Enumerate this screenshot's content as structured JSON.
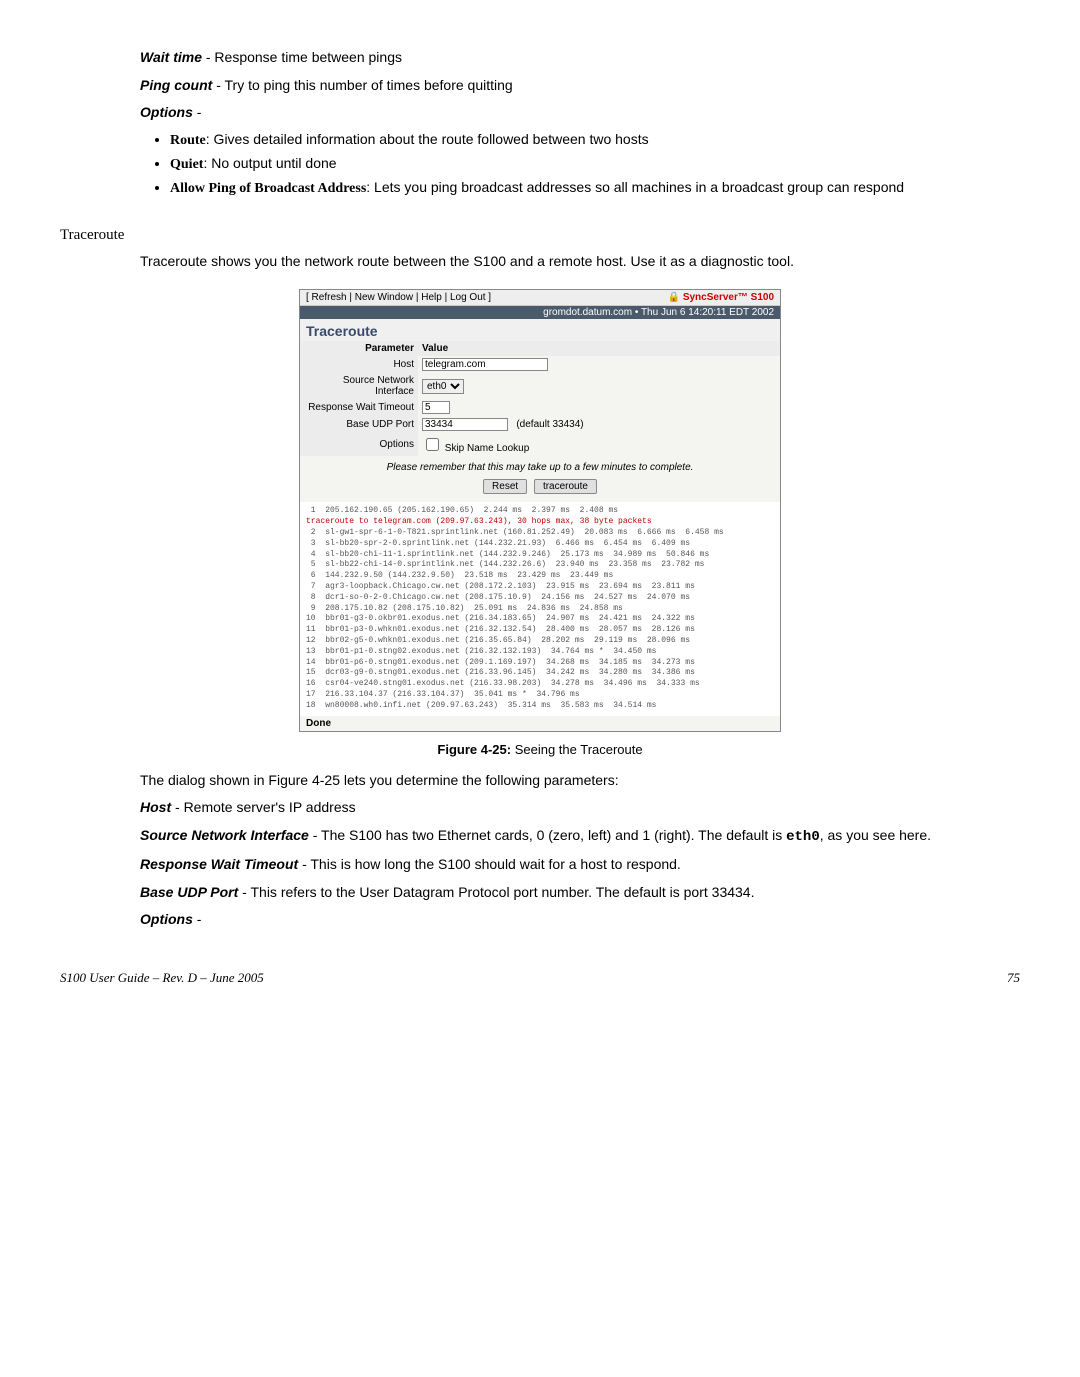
{
  "p1_label": "Wait time",
  "p1_text": " - Response time between pings",
  "p2_label": "Ping count",
  "p2_text": " - Try to ping this number of times before quitting",
  "p3_label": "Options",
  "p3_text": " -",
  "bullets": {
    "b1_label": "Route",
    "b1_text": ": Gives detailed information about the route followed between two hosts",
    "b2_label": "Quiet",
    "b2_text": ": No output until done",
    "b3_label": "Allow Ping of Broadcast Address",
    "b3_text": ": Lets you ping broadcast addresses so all machines in a broadcast group can respond"
  },
  "section_head": "Traceroute",
  "section_body": "Traceroute shows you the network route between the S100 and a remote host. Use it as a diagnostic tool.",
  "figure": {
    "links": "[ Refresh | New Window | Help | Log Out ]",
    "brand": "SyncServer™ S100",
    "banner": "gromdot.datum.com • Thu Jun 6 14:20:11 EDT 2002",
    "title": "Traceroute",
    "row_param": "Parameter",
    "row_val": "Value",
    "host_label": "Host",
    "host_value": "telegram.com",
    "sni_label": "Source Network Interface",
    "sni_value": "eth0",
    "rwt_label": "Response Wait Timeout",
    "rwt_value": "5",
    "bup_label": "Base UDP Port",
    "bup_value": "33434",
    "bup_note": "(default 33434)",
    "opt_label": "Options",
    "opt_check": "Skip Name Lookup",
    "note": "Please remember that this may take up to a few minutes to complete.",
    "btn_reset": "Reset",
    "btn_trace": "traceroute",
    "trace_lines": [
      " 1  205.162.190.65 (205.162.190.65)  2.244 ms  2.397 ms  2.408 ms",
      "traceroute to telegram.com (209.97.63.243), 30 hops max, 38 byte packets",
      " 2  sl-gw1-spr-6-1-0-T821.sprintlink.net (160.81.252.49)  20.083 ms  6.666 ms  6.458 ms",
      " 3  sl-bb20-spr-2-0.sprintlink.net (144.232.21.93)  6.466 ms  6.454 ms  6.409 ms",
      " 4  sl-bb20-chi-11-1.sprintlink.net (144.232.9.246)  25.173 ms  34.989 ms  50.846 ms",
      " 5  sl-bb22-chi-14-0.sprintlink.net (144.232.26.6)  23.940 ms  23.358 ms  23.782 ms",
      " 6  144.232.9.50 (144.232.9.50)  23.518 ms  23.429 ms  23.449 ms",
      " 7  agr3-loopback.Chicago.cw.net (208.172.2.103)  23.915 ms  23.694 ms  23.811 ms",
      " 8  dcr1-so-0-2-0.Chicago.cw.net (208.175.10.9)  24.156 ms  24.527 ms  24.070 ms",
      " 9  208.175.10.82 (208.175.10.82)  25.091 ms  24.836 ms  24.858 ms",
      "10  bbr01-g3-0.okbr01.exodus.net (216.34.183.65)  24.907 ms  24.421 ms  24.322 ms",
      "11  bbr01-p3-0.whkn01.exodus.net (216.32.132.54)  28.400 ms  28.057 ms  28.126 ms",
      "12  bbr02-g5-0.whkn01.exodus.net (216.35.65.84)  28.202 ms  29.119 ms  28.096 ms",
      "13  bbr01-p1-0.stng02.exodus.net (216.32.132.193)  34.764 ms *  34.450 ms",
      "14  bbr01-p6-0.stng01.exodus.net (209.1.169.197)  34.268 ms  34.185 ms  34.273 ms",
      "15  dcr03-g9-0.stng01.exodus.net (216.33.96.145)  34.242 ms  34.280 ms  34.386 ms",
      "16  csr04-ve240.stng01.exodus.net (216.33.98.203)  34.278 ms  34.496 ms  34.333 ms",
      "17  216.33.104.37 (216.33.104.37)  35.041 ms *  34.796 ms",
      "18  wn80008.wh0.infi.net (209.97.63.243)  35.314 ms  35.583 ms  34.514 ms"
    ],
    "done": "Done"
  },
  "caption_label": "Figure 4-25:",
  "caption_text": "  Seeing the Traceroute",
  "dialog_intro": "The dialog shown in Figure 4-25 lets you determine the following parameters:",
  "host_lbl": "Host",
  "host_txt": " - Remote server's IP address",
  "sni_lbl": "Source Network Interface",
  "sni_txt_a": " - The S100 has two Ethernet cards, 0 (zero, left) and 1 (right). The default is ",
  "sni_mono": "eth0",
  "sni_txt_b": ", as you see here.",
  "rwt_lbl": "Response Wait Timeout",
  "rwt_txt": " - This is how long the S100 should wait for a host to respond.",
  "bup_lbl": "Base UDP Port",
  "bup_txt": " - This refers to the User Datagram Protocol port number. The default is port 33434.",
  "opt2_label": "Options",
  "opt2_text": " -",
  "footer_left": "S100 User Guide – Rev. D – June 2005",
  "footer_right": "75"
}
